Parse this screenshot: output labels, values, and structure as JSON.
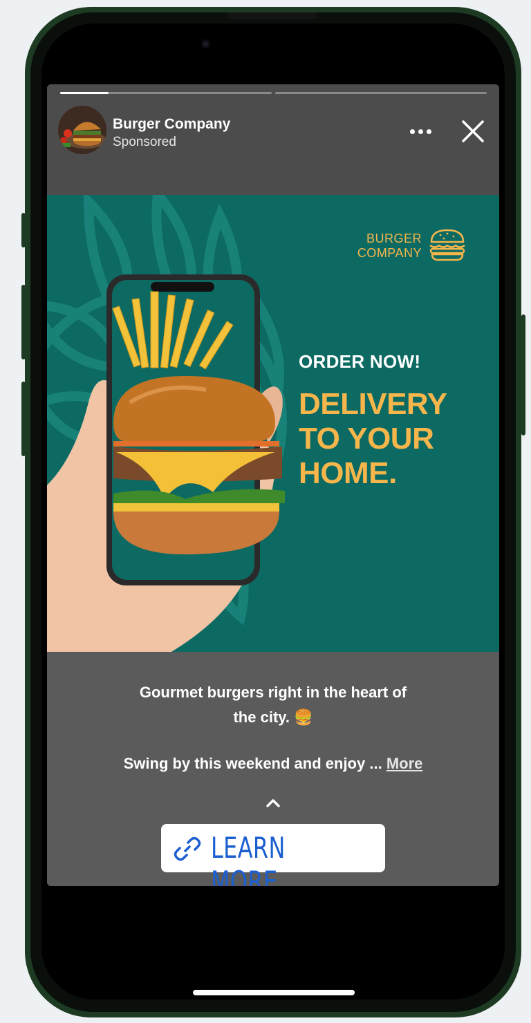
{
  "story": {
    "progress_segments": [
      {
        "filled_fraction": 0.23
      },
      {
        "filled_fraction": 0
      }
    ],
    "header": {
      "account_name": "Burger Company",
      "sponsored_label": "Sponsored",
      "more_icon": "more-horizontal-icon",
      "close_icon": "close-icon"
    },
    "ad": {
      "logo_line1": "BURGER",
      "logo_line2": "COMPANY",
      "logo_icon": "burger-icon",
      "order_text": "ORDER NOW!",
      "headline_lines": [
        "DELIVERY",
        "TO YOUR",
        "HOME."
      ],
      "colors": {
        "background": "#0d6a63",
        "accent": "#f6b64b"
      }
    },
    "caption": {
      "line1": "Gourmet burgers right in the heart of",
      "line2": "the city. 🍔",
      "line3": "Swing by this weekend and enjoy ...",
      "more_label": "More"
    },
    "cta": {
      "label": "LEARN MORE",
      "icon": "link-icon",
      "expand_icon": "chevron-up-icon"
    }
  }
}
